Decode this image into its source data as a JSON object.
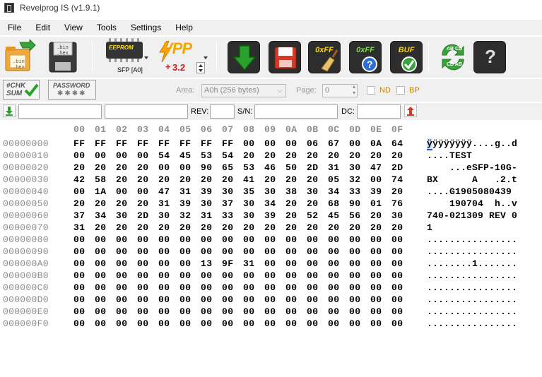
{
  "window": {
    "title": "Revelprog IS (v1.9.1)"
  },
  "menu": [
    "File",
    "Edit",
    "View",
    "Tools",
    "Settings",
    "Help"
  ],
  "toolbar": {
    "open_icon_text": ".bin\n.hex",
    "save_icon_text": ".bin\n.hex",
    "chip_label": "EEPROM",
    "chip_type": "SFP [A0]",
    "vpp_label": "VPP",
    "vpp_value": "3.2",
    "ff_label": "0xFF",
    "ff_check_label": "0xFF",
    "buf_label": "BUF",
    "swap_label_top": "AB CD",
    "swap_label_bottom": "CD AB",
    "help_label": "?"
  },
  "options": {
    "chksum_label": "#CHK SUM",
    "password_label": "PASSWORD",
    "area_label": "Area:",
    "area_value": "A0h (256 bytes)",
    "page_label": "Page:",
    "page_value": "0",
    "nd_label": "ND",
    "bp_label": "BP"
  },
  "info": {
    "field1": "",
    "field2": "",
    "rev_label": "REV:",
    "rev_value": "",
    "sn_label": "S/N:",
    "sn_value": "",
    "dc_label": "DC:",
    "dc_value": ""
  },
  "hex": {
    "columns": [
      "00",
      "01",
      "02",
      "03",
      "04",
      "05",
      "06",
      "07",
      "08",
      "09",
      "0A",
      "0B",
      "0C",
      "0D",
      "0E",
      "0F"
    ],
    "rows": [
      {
        "addr": "00000000",
        "bytes": [
          "FF",
          "FF",
          "FF",
          "FF",
          "FF",
          "FF",
          "FF",
          "FF",
          "00",
          "00",
          "00",
          "06",
          "67",
          "00",
          "0A",
          "64"
        ],
        "ascii": "ÿÿÿÿÿÿÿÿ....g..d"
      },
      {
        "addr": "00000010",
        "bytes": [
          "00",
          "00",
          "00",
          "00",
          "54",
          "45",
          "53",
          "54",
          "20",
          "20",
          "20",
          "20",
          "20",
          "20",
          "20",
          "20"
        ],
        "ascii": "....TEST        "
      },
      {
        "addr": "00000020",
        "bytes": [
          "20",
          "20",
          "20",
          "20",
          "00",
          "00",
          "90",
          "65",
          "53",
          "46",
          "50",
          "2D",
          "31",
          "30",
          "47",
          "2D"
        ],
        "ascii": "    ...eSFP-10G-"
      },
      {
        "addr": "00000030",
        "bytes": [
          "42",
          "58",
          "20",
          "20",
          "20",
          "20",
          "20",
          "20",
          "41",
          "20",
          "20",
          "20",
          "05",
          "32",
          "00",
          "74"
        ],
        "ascii": "BX      A   .2.t"
      },
      {
        "addr": "00000040",
        "bytes": [
          "00",
          "1A",
          "00",
          "00",
          "47",
          "31",
          "39",
          "30",
          "35",
          "30",
          "38",
          "30",
          "34",
          "33",
          "39",
          "20"
        ],
        "ascii": "....G1905080439 "
      },
      {
        "addr": "00000050",
        "bytes": [
          "20",
          "20",
          "20",
          "20",
          "31",
          "39",
          "30",
          "37",
          "30",
          "34",
          "20",
          "20",
          "68",
          "90",
          "01",
          "76"
        ],
        "ascii": "    190704  h..v"
      },
      {
        "addr": "00000060",
        "bytes": [
          "37",
          "34",
          "30",
          "2D",
          "30",
          "32",
          "31",
          "33",
          "30",
          "39",
          "20",
          "52",
          "45",
          "56",
          "20",
          "30"
        ],
        "ascii": "740-021309 REV 0"
      },
      {
        "addr": "00000070",
        "bytes": [
          "31",
          "20",
          "20",
          "20",
          "20",
          "20",
          "20",
          "20",
          "20",
          "20",
          "20",
          "20",
          "20",
          "20",
          "20",
          "20"
        ],
        "ascii": "1               "
      },
      {
        "addr": "00000080",
        "bytes": [
          "00",
          "00",
          "00",
          "00",
          "00",
          "00",
          "00",
          "00",
          "00",
          "00",
          "00",
          "00",
          "00",
          "00",
          "00",
          "00"
        ],
        "ascii": "................"
      },
      {
        "addr": "00000090",
        "bytes": [
          "00",
          "00",
          "00",
          "00",
          "00",
          "00",
          "00",
          "00",
          "00",
          "00",
          "00",
          "00",
          "00",
          "00",
          "00",
          "00"
        ],
        "ascii": "................"
      },
      {
        "addr": "000000A0",
        "bytes": [
          "00",
          "00",
          "00",
          "00",
          "00",
          "00",
          "13",
          "9F",
          "31",
          "00",
          "00",
          "00",
          "00",
          "00",
          "00",
          "00"
        ],
        "ascii": "........1......."
      },
      {
        "addr": "000000B0",
        "bytes": [
          "00",
          "00",
          "00",
          "00",
          "00",
          "00",
          "00",
          "00",
          "00",
          "00",
          "00",
          "00",
          "00",
          "00",
          "00",
          "00"
        ],
        "ascii": "................"
      },
      {
        "addr": "000000C0",
        "bytes": [
          "00",
          "00",
          "00",
          "00",
          "00",
          "00",
          "00",
          "00",
          "00",
          "00",
          "00",
          "00",
          "00",
          "00",
          "00",
          "00"
        ],
        "ascii": "................"
      },
      {
        "addr": "000000D0",
        "bytes": [
          "00",
          "00",
          "00",
          "00",
          "00",
          "00",
          "00",
          "00",
          "00",
          "00",
          "00",
          "00",
          "00",
          "00",
          "00",
          "00"
        ],
        "ascii": "................"
      },
      {
        "addr": "000000E0",
        "bytes": [
          "00",
          "00",
          "00",
          "00",
          "00",
          "00",
          "00",
          "00",
          "00",
          "00",
          "00",
          "00",
          "00",
          "00",
          "00",
          "00"
        ],
        "ascii": "................"
      },
      {
        "addr": "000000F0",
        "bytes": [
          "00",
          "00",
          "00",
          "00",
          "00",
          "00",
          "00",
          "00",
          "00",
          "00",
          "00",
          "00",
          "00",
          "00",
          "00",
          "00"
        ],
        "ascii": "................"
      }
    ]
  },
  "colors": {
    "toolbar_bg": "#f0f0f0",
    "vpp_orange": "#f7a600",
    "vpp_red": "#d21b1b",
    "green_arrow": "#2aa12a",
    "red_arrow": "#d23a2a"
  }
}
